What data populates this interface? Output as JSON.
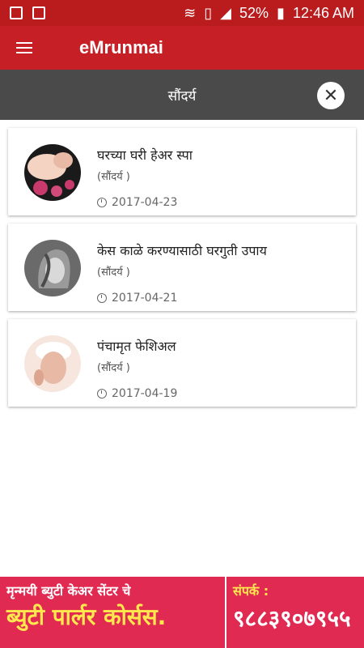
{
  "status_bar": {
    "battery": "52%",
    "time": "12:46 AM",
    "icons": [
      "gallery-icon",
      "briefcase-icon",
      "wifi-icon",
      "sim-icon",
      "signal-icon",
      "battery-icon"
    ]
  },
  "toolbar": {
    "title": "eMrunmai",
    "menu_icon": "menu-icon"
  },
  "category": {
    "title": "सौंदर्य",
    "close_icon": "close-icon"
  },
  "articles": [
    {
      "title": "घरच्या घरी हेअर स्पा",
      "category": "(सौंदर्य )",
      "date": "2017-04-23",
      "thumb_colors": [
        "#f4d3c2",
        "#1a1a1a",
        "#c73a6b"
      ]
    },
    {
      "title": "केस काळे करण्यासाठी घरगुती उपाय",
      "category": "(सौंदर्य )",
      "date": "2017-04-21",
      "thumb_colors": [
        "#6a6a6a",
        "#d9d9d9",
        "#9a9a9a"
      ]
    },
    {
      "title": "पंचामृत फेशिअल",
      "category": "(सौंदर्य )",
      "date": "2017-04-19",
      "thumb_colors": [
        "#f6e6de",
        "#ffffff",
        "#e8b9a5"
      ]
    }
  ],
  "banner": {
    "line1": "मृन्मयी ब्युटी केअर सेंटर चे",
    "line2": "ब्युटी पार्लर कोर्सस.",
    "contact_label": "संपर्क :",
    "phone": "९८८३९०७९५५"
  },
  "colors": {
    "status_bar": "#ba1b1d",
    "toolbar": "#c62026",
    "category_bar": "#4a4a4a",
    "banner": "#e12a52",
    "banner_accent": "#ffe84d"
  }
}
